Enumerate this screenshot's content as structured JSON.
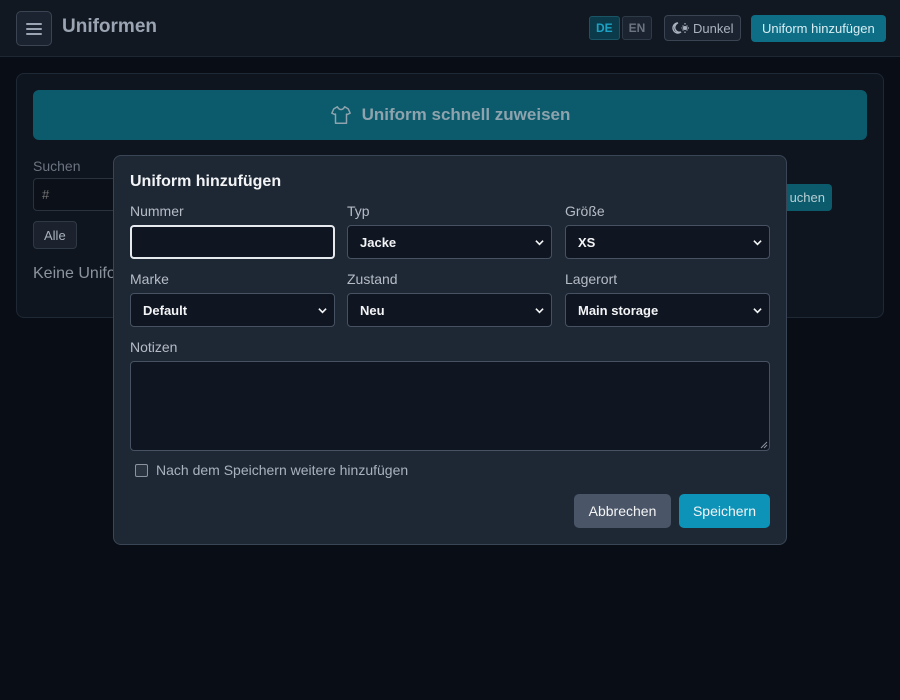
{
  "header": {
    "title": "Uniformen",
    "languages": [
      "DE",
      "EN"
    ],
    "active_language": "DE",
    "theme_label": "Dunkel",
    "add_button": "Uniform hinzufügen"
  },
  "main": {
    "quick_assign_label": "Uniform schnell zuweisen",
    "search_label": "Suchen",
    "search_placeholder": "#",
    "search_button_visible_text": "uchen",
    "filter_all": "Alle",
    "empty_text_visible": "Keine Unifo"
  },
  "modal": {
    "title": "Uniform hinzufügen",
    "fields": {
      "number": {
        "label": "Nummer",
        "value": ""
      },
      "type": {
        "label": "Typ",
        "value": "Jacke"
      },
      "size": {
        "label": "Größe",
        "value": "XS"
      },
      "brand": {
        "label": "Marke",
        "value": "Default"
      },
      "condition": {
        "label": "Zustand",
        "value": "Neu"
      },
      "location": {
        "label": "Lagerort",
        "value": "Main storage"
      }
    },
    "notes_label": "Notizen",
    "notes_value": "",
    "add_more_label": "Nach dem Speichern weitere hinzufügen",
    "add_more_checked": false,
    "cancel_label": "Abbrechen",
    "save_label": "Speichern"
  },
  "colors": {
    "accent": "#0e93b8",
    "header_bg": "#121821",
    "modal_bg": "#1e2835",
    "page_bg": "#090d15"
  },
  "icons": {
    "menu": "hamburger-menu-icon",
    "theme": "moon-sun-icon",
    "quick_assign": "shirt-icon",
    "select": "chevron-down-icon"
  }
}
